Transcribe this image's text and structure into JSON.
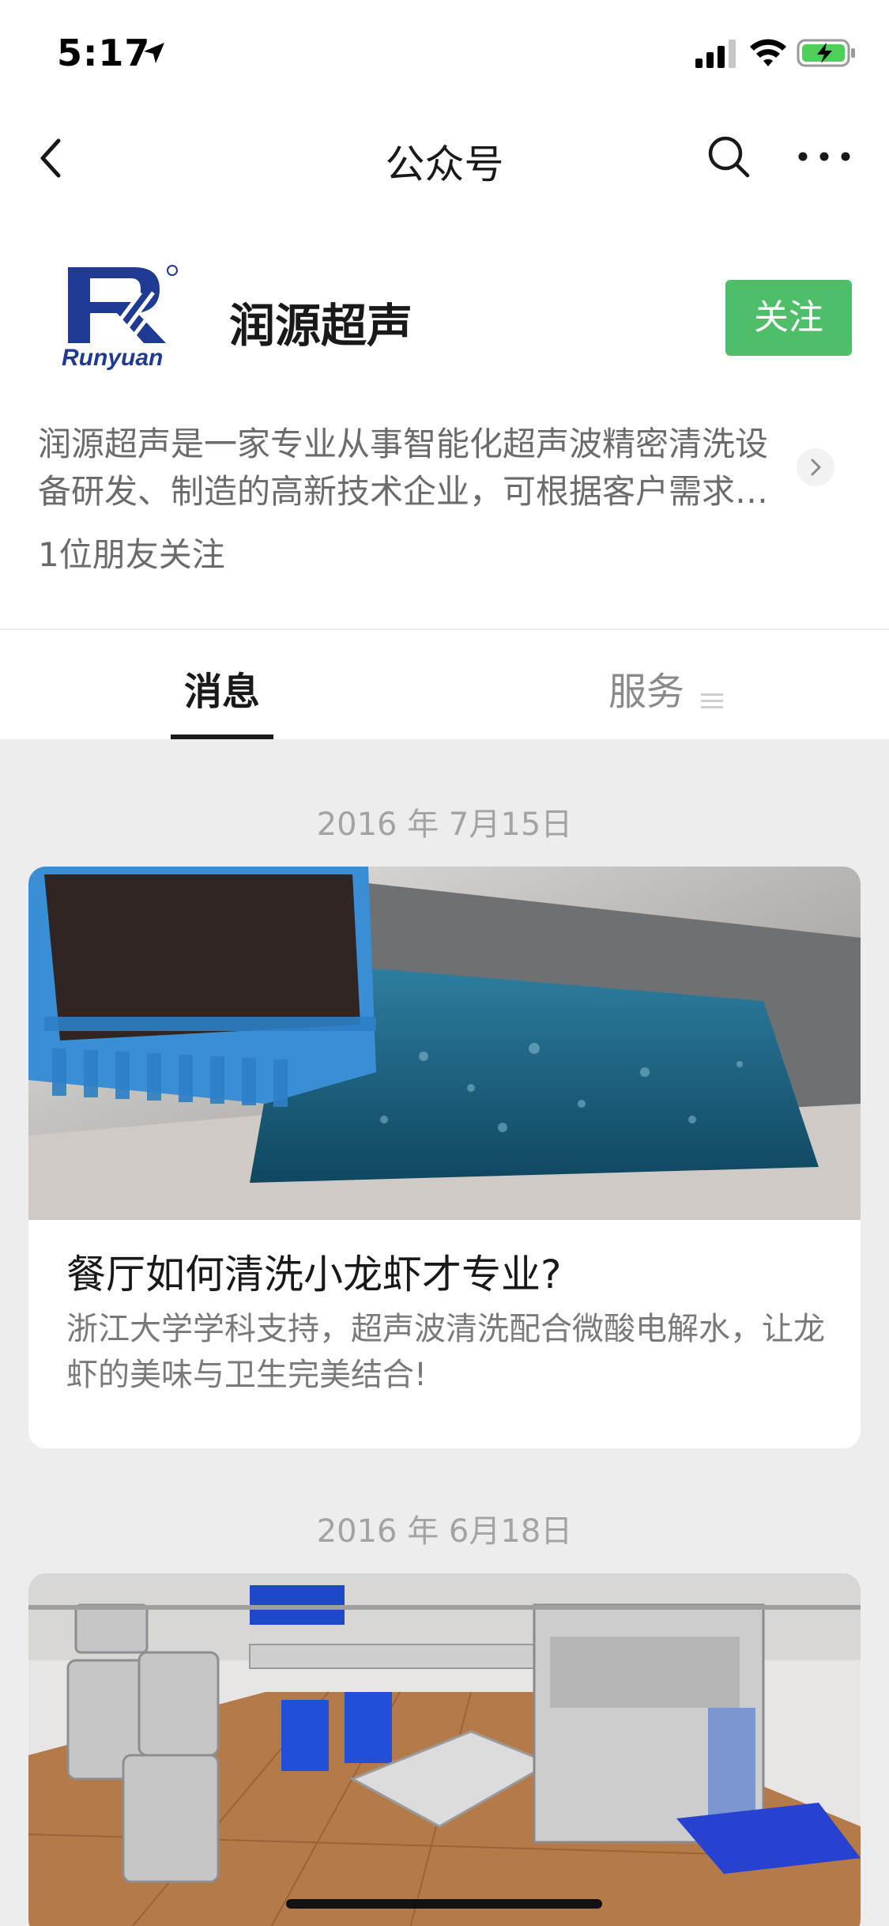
{
  "status_bar": {
    "time": "5:17"
  },
  "nav": {
    "title": "公众号"
  },
  "profile": {
    "logo_text": "Runyuan",
    "name": "润源超声",
    "follow_label": "关注",
    "description": "润源超声是一家专业从事智能化超声波精密清洗设备研发、制造的高新技术企业，可根据客户需求…",
    "friends": "1位朋友关注"
  },
  "tabs": [
    {
      "label": "消息",
      "active": true
    },
    {
      "label": "服务",
      "active": false
    }
  ],
  "feed": [
    {
      "date": "2016 年 7月15日",
      "title": "餐厅如何清洗小龙虾才专业?",
      "digest": "浙江大学学科支持，超声波清洗配合微酸电解水，让龙虾的美味与卫生完美结合!"
    },
    {
      "date": "2016 年 6月18日"
    }
  ],
  "colors": {
    "follow_button": "#4fbe68",
    "brand_blue": "#1f3a93",
    "background": "#ededed"
  }
}
